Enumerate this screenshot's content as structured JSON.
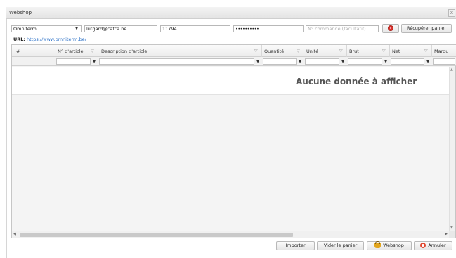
{
  "window": {
    "title": "Webshop",
    "close_glyph": "x"
  },
  "form": {
    "supplier": "Omniterm",
    "email": "lutgard@cafca.be",
    "customer_number": "11794",
    "password_mask": "••••••••••",
    "order_number_placeholder": "N° commande (facultatif)",
    "retrieve_cart_label": "Récupérer panier"
  },
  "url": {
    "label": "URL:",
    "value": "https://www.omniterm.be/"
  },
  "grid": {
    "columns": [
      "#",
      "N° d'article",
      "Description d'article",
      "Quantité",
      "Unité",
      "Brut",
      "Net",
      "Marqu"
    ],
    "empty_message": "Aucune donnée à afficher"
  },
  "footer": {
    "import_label": "Importer",
    "clear_cart_label": "Vider le panier",
    "webshop_label": "Webshop",
    "cancel_label": "Annuler"
  },
  "colors": {
    "accent_red": "#d9342b",
    "link_blue": "#2f73c8"
  },
  "icons": [
    "close-icon",
    "dropdown-arrow-icon",
    "red-stop-icon",
    "filter-funnel-icon",
    "basket-icon",
    "cancel-icon"
  ]
}
